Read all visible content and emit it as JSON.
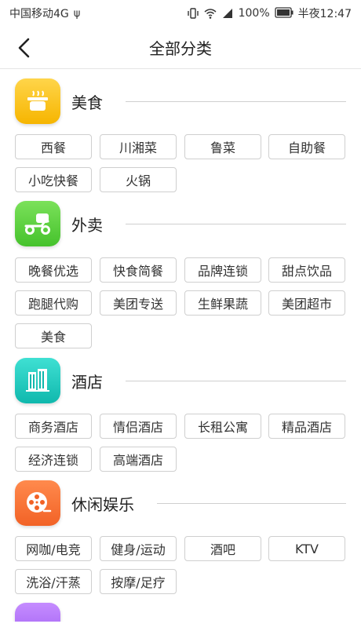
{
  "status_bar": {
    "carrier": "中国移动4G",
    "battery": "100%",
    "time": "半夜12:47"
  },
  "nav": {
    "title": "全部分类"
  },
  "sections": [
    {
      "title": "美食",
      "icon": "food-pot-icon",
      "color": "#f6b500",
      "tags": [
        "西餐",
        "川湘菜",
        "鲁菜",
        "自助餐",
        "小吃快餐",
        "火锅"
      ]
    },
    {
      "title": "外卖",
      "icon": "delivery-scooter-icon",
      "color": "#45c22c",
      "tags": [
        "晚餐优选",
        "快食简餐",
        "品牌连锁",
        "甜点饮品",
        "跑腿代购",
        "美团专送",
        "生鲜果蔬",
        "美团超市",
        "美食"
      ]
    },
    {
      "title": "酒店",
      "icon": "hotel-building-icon",
      "color": "#10b8ad",
      "tags": [
        "商务酒店",
        "情侣酒店",
        "长租公寓",
        "精品酒店",
        "经济连锁",
        "高端酒店"
      ]
    },
    {
      "title": "休闲娱乐",
      "icon": "film-reel-icon",
      "color": "#f26226",
      "tags": [
        "网咖/电竞",
        "健身/运动",
        "酒吧",
        "KTV",
        "洗浴/汗蒸",
        "按摩/足疗"
      ]
    },
    {
      "title": "",
      "icon": "partial-icon",
      "color": "#9b58f0",
      "tags": []
    }
  ]
}
